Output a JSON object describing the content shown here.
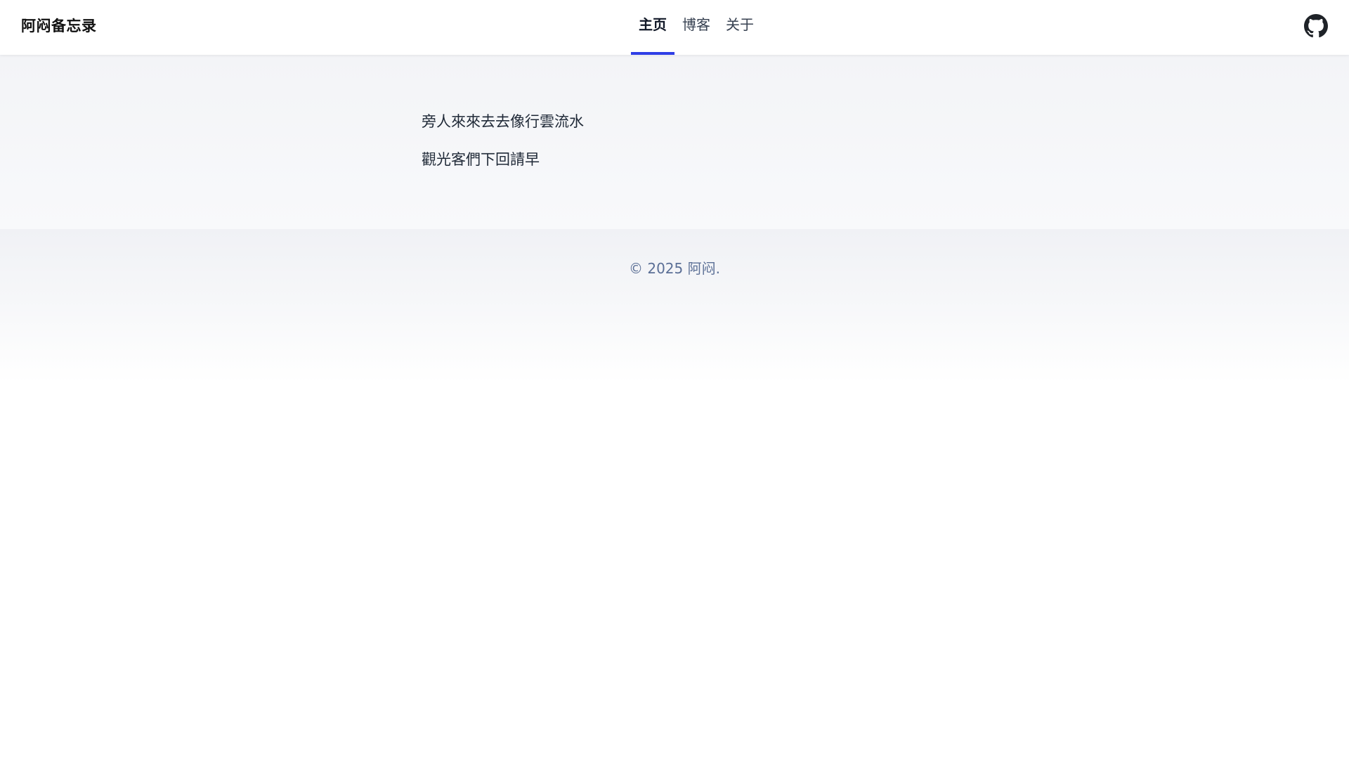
{
  "header": {
    "brand": "阿闷备忘录",
    "nav": [
      {
        "label": "主页",
        "active": true
      },
      {
        "label": "博客",
        "active": false
      },
      {
        "label": "关于",
        "active": false
      }
    ],
    "github_icon": "github-icon"
  },
  "main": {
    "lines": [
      "旁人來來去去像行雲流水",
      "觀光客們下回請早"
    ]
  },
  "footer": {
    "copyright": "© 2025 阿闷."
  },
  "colors": {
    "accent": "#2f3ee6",
    "footer_text": "#5b6f96"
  }
}
